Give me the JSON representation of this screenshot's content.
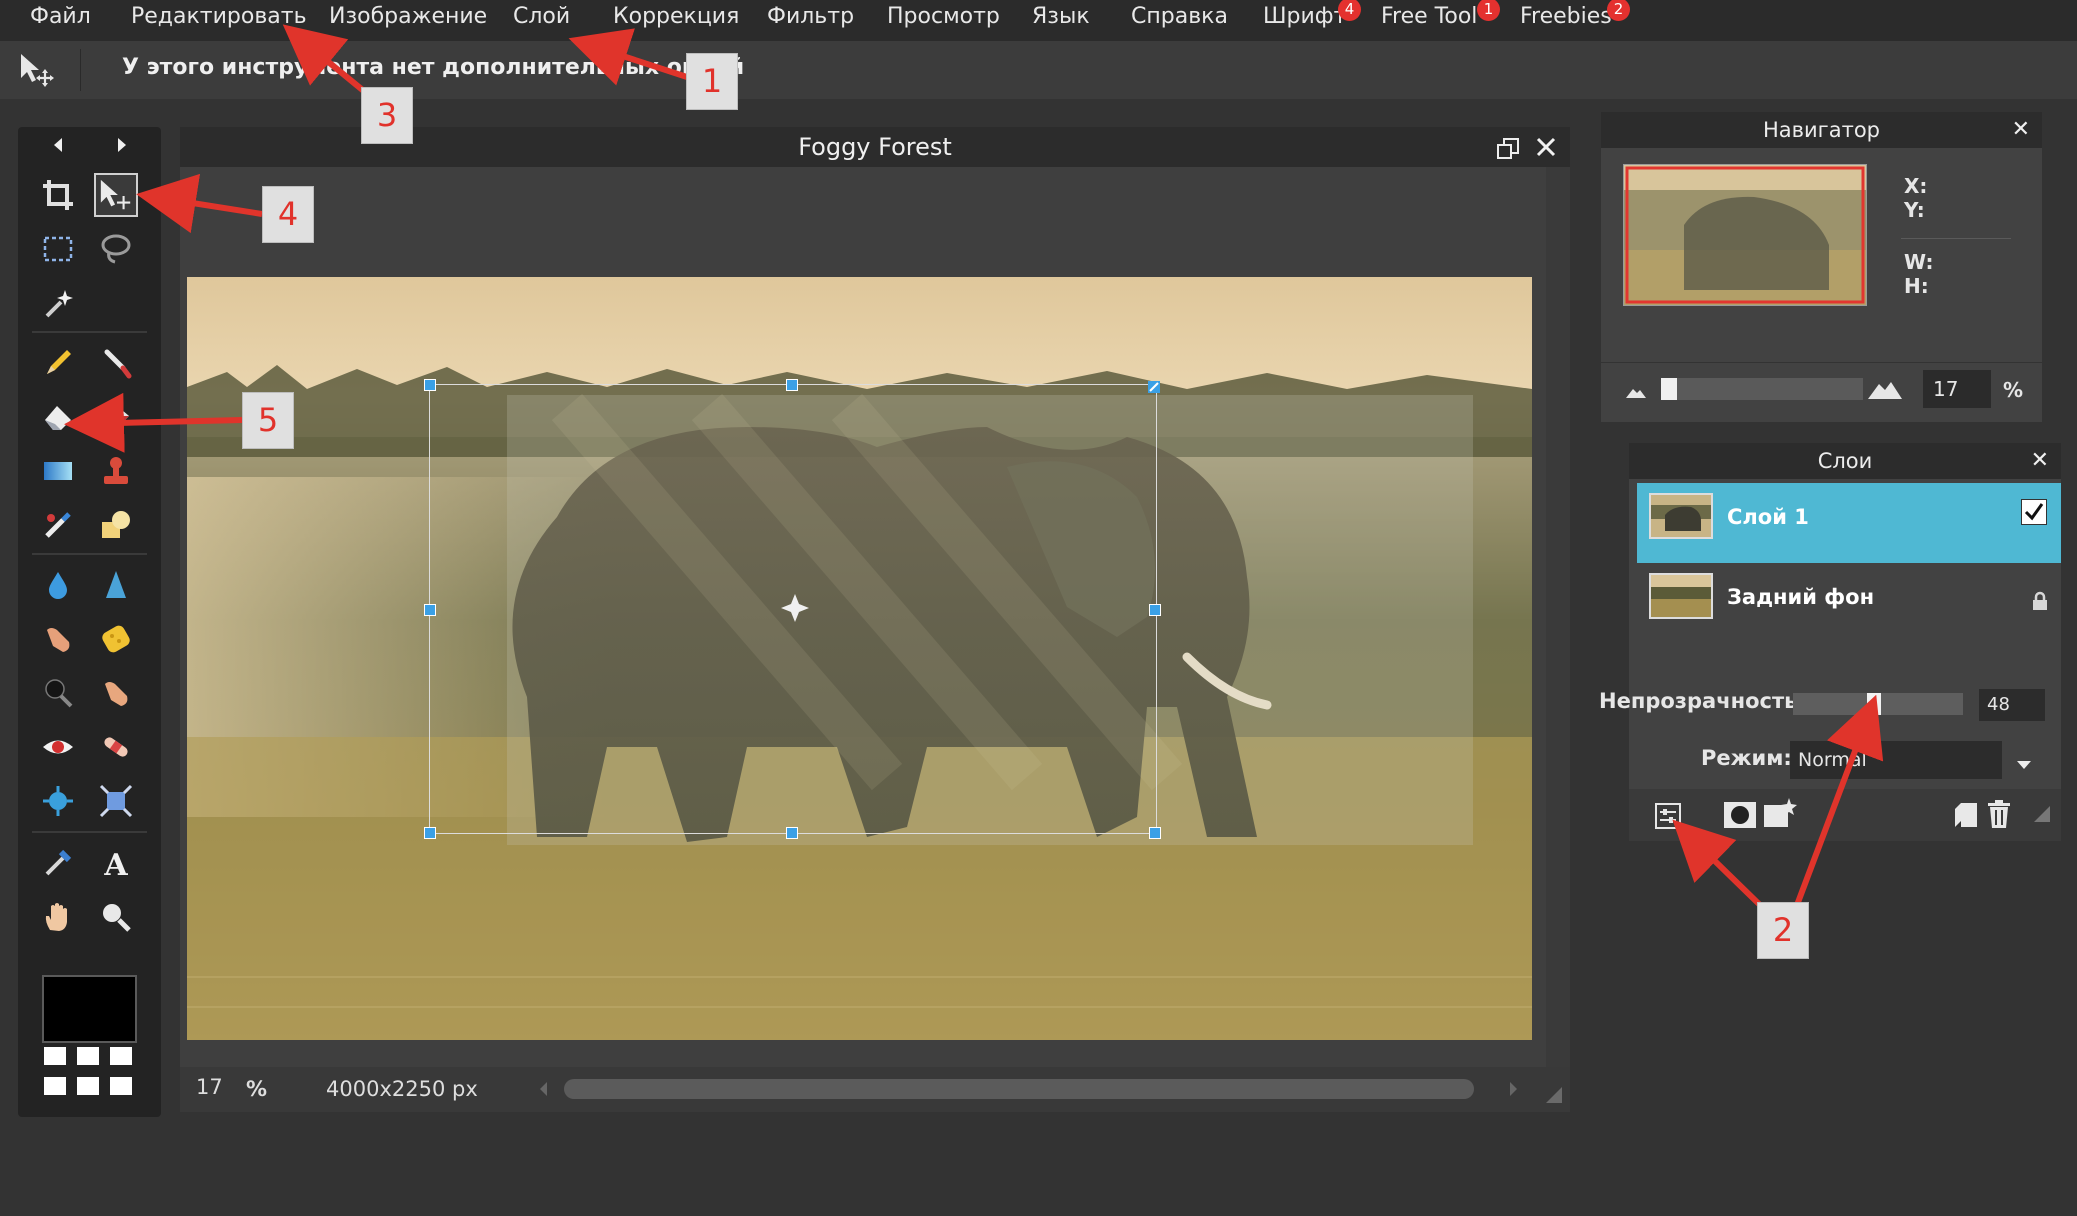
{
  "menu": {
    "items": [
      "Файл",
      "Редактировать",
      "Изображение",
      "Слой",
      "Коррекция",
      "Фильтр",
      "Просмотр",
      "Язык",
      "Справка",
      "Шрифт",
      "Free Tool",
      "Freebies"
    ],
    "badges": {
      "font": "4",
      "free_tool": "1",
      "freebies": "2"
    }
  },
  "options_bar": {
    "text": "У этого инструмента нет дополнительных опций"
  },
  "document": {
    "title": "Foggy Forest",
    "zoom": "17",
    "zoom_unit": "%",
    "dimensions": "4000x2250 px"
  },
  "navigator": {
    "title": "Навигатор",
    "x_label": "X:",
    "y_label": "Y:",
    "w_label": "W:",
    "h_label": "H:",
    "zoom_value": "17",
    "zoom_unit": "%"
  },
  "layers": {
    "title": "Слои",
    "items": [
      {
        "name": "Слой 1",
        "selected": true,
        "visible": true
      },
      {
        "name": "Задний фон",
        "selected": false,
        "locked": true
      }
    ],
    "opacity_label": "Непрозрачность:",
    "opacity_value": "48",
    "mode_label": "Режим:",
    "mode_value": "Normal"
  },
  "callouts": [
    "1",
    "2",
    "3",
    "4",
    "5"
  ],
  "colors": {
    "accent": "#4fb8d3",
    "badge": "#e4312f",
    "callout_text": "#e1322b",
    "arrow": "#e0342b"
  }
}
